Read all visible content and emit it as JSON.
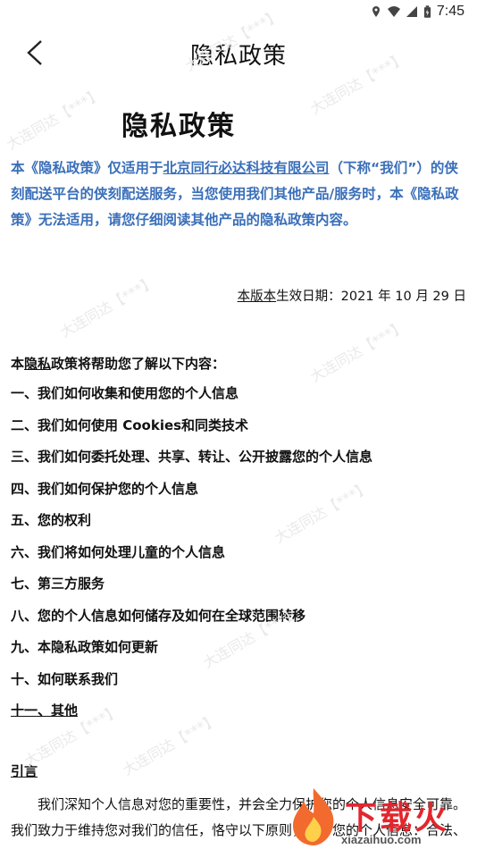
{
  "status_bar": {
    "time": "7:45",
    "icons": [
      "location-icon",
      "wifi-icon",
      "signal-icon",
      "battery-icon"
    ]
  },
  "nav": {
    "title": "隐私政策"
  },
  "doc": {
    "title": "隐私政策",
    "intro": {
      "p1": "本《隐私政策》仅适用于",
      "company": "北京同行必达科技有限公司",
      "p2": "（下称“我们”）的侠刻配送平台的侠刻配送服务，当您使用我们其他产品/服务时，本《隐私政策》无法适用，请您仔细阅读其他产品的隐私政策内容。"
    },
    "effective": {
      "a": "本版本",
      "b": "生效日期：2021 年 10 月 29 日"
    },
    "toc_intro": {
      "a": "本",
      "b": "隐私",
      "c": "政策将帮助您了解以下内容："
    },
    "toc": [
      "一、我们如何收集和使用您的个人信息",
      "二、我们如何使用 Cookies和同类技术",
      "三、我们如何委托处理、共享、转让、公开披露您的个人信息",
      "四、我们如何保护您的个人信息",
      "五、您的权利",
      "六、我们将如何处理儿童的个人信息",
      "七、第三方服务",
      "八、您的个人信息如何储存及如何在全球范围转移",
      "九、本隐私政策如何更新",
      "十、如何联系我们",
      "十一、其他"
    ],
    "preface_heading": "引言",
    "preface_text": "我们深知个人信息对您的重要性，并会全力保护您的个人信息安全可靠。我们致力于维持您对我们的信任，恪守以下原则，保护您的个人信息：合法、正当、必要和诚信原则、目的明确原则、选择同意原则、最"
  },
  "watermark_text": "大连同达【***】",
  "logo": {
    "brand": "下载火",
    "url": "xiazaihuo.com"
  },
  "colors": {
    "intro_blue": "#3a6fb9",
    "brand_red": "#e3262d"
  }
}
